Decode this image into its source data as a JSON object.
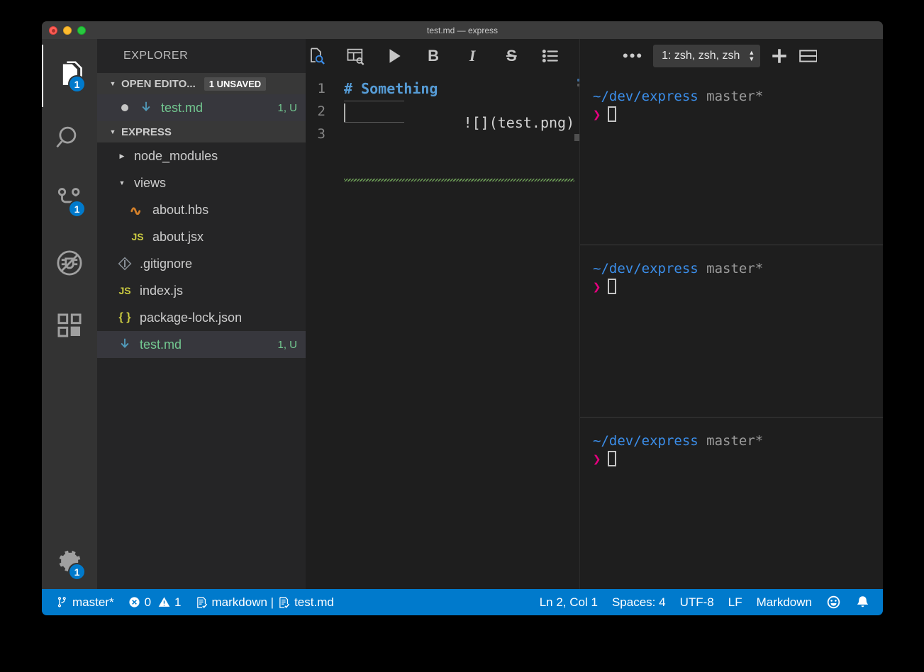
{
  "window": {
    "title": "test.md — express",
    "traffic_lights": [
      "close",
      "minimize",
      "maximize"
    ]
  },
  "activitybar": {
    "items": [
      {
        "name": "explorer",
        "icon": "files-icon",
        "badge": "1",
        "active": true
      },
      {
        "name": "search",
        "icon": "search-icon",
        "badge": "",
        "active": false
      },
      {
        "name": "source-control",
        "icon": "source-control-icon",
        "badge": "1",
        "active": false
      },
      {
        "name": "debug",
        "icon": "no-debug-icon",
        "badge": "",
        "active": false
      },
      {
        "name": "extensions",
        "icon": "extensions-icon",
        "badge": "",
        "active": false
      }
    ],
    "settings": {
      "name": "manage",
      "icon": "gear-icon",
      "badge": "1"
    }
  },
  "sidebar": {
    "title": "EXPLORER",
    "open_editors": {
      "label": "OPEN EDITO...",
      "badge": "1 UNSAVED",
      "expanded": true,
      "items": [
        {
          "label": "test.md",
          "meta": "1, U",
          "dirty": true,
          "icon": "markdown-icon",
          "selected": true
        }
      ]
    },
    "project": {
      "label": "EXPRESS",
      "expanded": true,
      "items": [
        {
          "label": "node_modules",
          "type": "folder",
          "expanded": false,
          "indent": 1,
          "icon": "chevron-right-icon",
          "meta": ""
        },
        {
          "label": "views",
          "type": "folder",
          "expanded": true,
          "indent": 1,
          "icon": "chevron-down-icon",
          "meta": ""
        },
        {
          "label": "about.hbs",
          "type": "file",
          "indent": 2,
          "icon": "handlebars-icon",
          "meta": ""
        },
        {
          "label": "about.jsx",
          "type": "file",
          "indent": 2,
          "icon": "js-icon",
          "meta": ""
        },
        {
          "label": ".gitignore",
          "type": "file",
          "indent": 1,
          "icon": "git-icon",
          "meta": ""
        },
        {
          "label": "index.js",
          "type": "file",
          "indent": 1,
          "icon": "js-icon",
          "meta": ""
        },
        {
          "label": "package-lock.json",
          "type": "file",
          "indent": 1,
          "icon": "json-icon",
          "meta": ""
        },
        {
          "label": "test.md",
          "type": "file",
          "indent": 1,
          "icon": "markdown-icon",
          "meta": "1, U",
          "selected": true
        }
      ]
    }
  },
  "editor": {
    "toolbar": [
      {
        "name": "open-preview",
        "icon": "preview-icon",
        "label": ""
      },
      {
        "name": "open-preview-to-side",
        "icon": "preview-side-icon",
        "label": ""
      },
      {
        "name": "run",
        "icon": "play-icon",
        "label": ""
      },
      {
        "name": "bold",
        "icon": "bold-icon",
        "label": "B"
      },
      {
        "name": "italic",
        "icon": "italic-icon",
        "label": "I"
      },
      {
        "name": "strikethrough",
        "icon": "strikethrough-icon",
        "label": "S"
      },
      {
        "name": "bullet-list",
        "icon": "list-icon",
        "label": ""
      }
    ],
    "lines": [
      {
        "number": "1",
        "text": "# Something",
        "kind": "heading"
      },
      {
        "number": "2",
        "text": "",
        "kind": "current"
      },
      {
        "number": "3",
        "text": "![](test.png)",
        "kind": "plain-warning"
      }
    ]
  },
  "panel": {
    "more_label": "•••",
    "terminal_select": "1: zsh, zsh, zsh",
    "add_label": "+",
    "split_name": "split-terminal-icon",
    "terminals": [
      {
        "path": "~/dev/express",
        "branch": "master*",
        "prompt": "❯",
        "command": ""
      },
      {
        "path": "~/dev/express",
        "branch": "master*",
        "prompt": "❯",
        "command": ""
      },
      {
        "path": "~/dev/express",
        "branch": "master*",
        "prompt": "❯",
        "command": ""
      }
    ]
  },
  "statusbar": {
    "branch": "master*",
    "errors": "0",
    "warnings": "1",
    "language_server": "markdown | ",
    "file": "test.md",
    "position": "Ln 2, Col 1",
    "indent": "Spaces: 4",
    "encoding": "UTF-8",
    "eol": "LF",
    "language": "Markdown",
    "feedback_icon": "smiley-icon",
    "notifications_icon": "bell-icon"
  },
  "colors": {
    "accent": "#007acc",
    "badge": "#007acc",
    "heading": "#569cd6",
    "green_text": "#73c991",
    "terminal_path": "#3b8eea",
    "terminal_prompt": "#e5007f"
  }
}
